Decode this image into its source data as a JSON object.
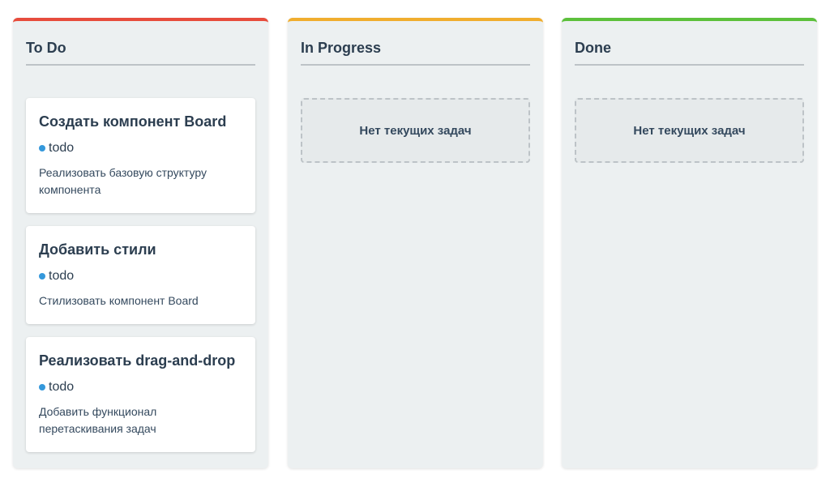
{
  "columns": [
    {
      "title": "To Do",
      "accent_color": "#e74c3c",
      "empty_text": "",
      "tasks": [
        {
          "title": "Создать компонент Board",
          "status": "todo",
          "description": "Реализовать базовую структуру компонента"
        },
        {
          "title": "Добавить стили",
          "status": "todo",
          "description": "Стилизовать компонент Board"
        },
        {
          "title": "Реализовать drag-and-drop",
          "status": "todo",
          "description": "Добавить функционал перетаскивания задач"
        }
      ]
    },
    {
      "title": "In Progress",
      "accent_color": "#f0ad2e",
      "empty_text": "Нет текущих задач",
      "tasks": []
    },
    {
      "title": "Done",
      "accent_color": "#5cc03b",
      "empty_text": "Нет текущих задач",
      "tasks": []
    }
  ],
  "status_dot_color": "#3498db"
}
